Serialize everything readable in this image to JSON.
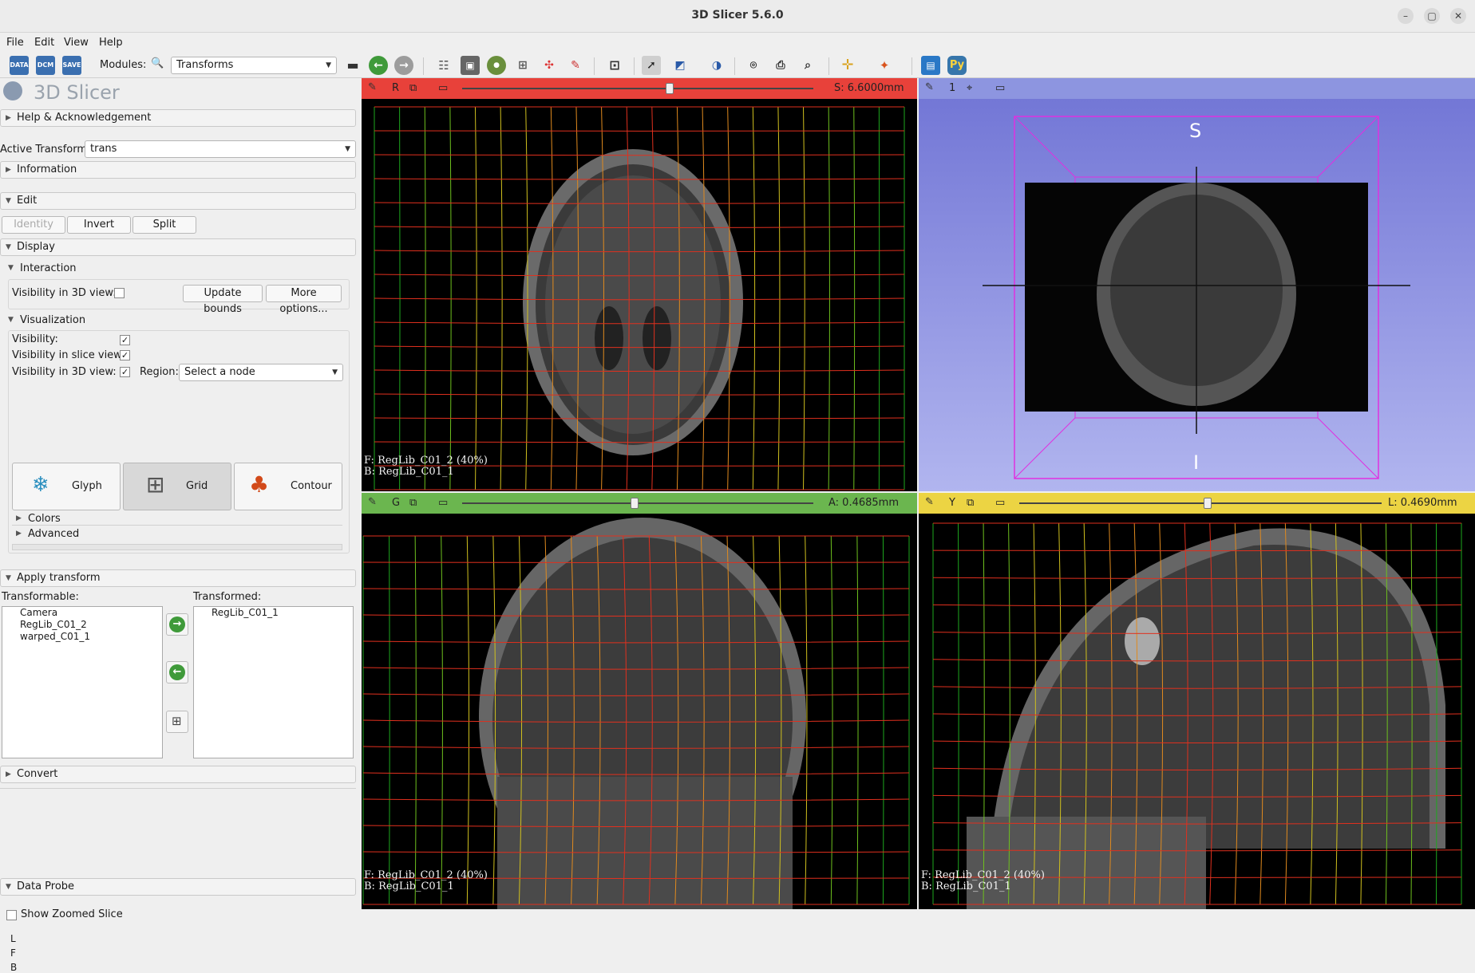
{
  "window": {
    "title": "3D Slicer 5.6.0"
  },
  "menu": [
    "File",
    "Edit",
    "View",
    "Help"
  ],
  "toolbar": {
    "data_btn": "DATA",
    "dcm_btn": "DCM",
    "save_btn": "SAVE",
    "modules_label": "Modules:",
    "module_selected": "Transforms"
  },
  "logo_text": "3D Slicer",
  "panels": {
    "help": "Help & Acknowledgement",
    "active_transform_label": "Active Transform:",
    "active_transform_value": "trans",
    "information": "Information",
    "edit": "Edit",
    "identity": "Identity",
    "invert": "Invert",
    "split": "Split",
    "display": "Display",
    "interaction": "Interaction",
    "vis3d_label": "Visibility in 3D view:",
    "update_bounds": "Update bounds",
    "more_options": "More options...",
    "visualization": "Visualization",
    "visibility_label": "Visibility:",
    "vis_slice_label": "Visibility in slice view:",
    "vis3d_label2": "Visibility in 3D view:",
    "region_label": "Region:",
    "region_value": "Select a node",
    "glyph": "Glyph",
    "grid": "Grid",
    "contour": "Contour",
    "colors": "Colors",
    "advanced": "Advanced",
    "apply_transform": "Apply transform",
    "transformable_label": "Transformable:",
    "transformed_label": "Transformed:",
    "transformable_items": [
      "Camera",
      "RegLib_C01_2",
      "warped_C01_1"
    ],
    "transformed_items": [
      "RegLib_C01_1"
    ],
    "convert": "Convert",
    "data_probe": "Data Probe",
    "show_zoomed": "Show Zoomed Slice",
    "probe_lines": [
      "L",
      "F",
      "B"
    ]
  },
  "views": {
    "red": {
      "letter": "R",
      "offset": "S: 6.6000mm",
      "fg": "F: RegLib_C01_2 (40%)",
      "bg": "B: RegLib_C01_1",
      "slider_pos": 0.59,
      "color": "#e8413a"
    },
    "threed": {
      "letter": "1",
      "s_label": "S",
      "i_label": "I",
      "color": "#8d95e0"
    },
    "green": {
      "letter": "G",
      "offset": "A: 0.4685mm",
      "fg": "F: RegLib_C01_2 (40%)",
      "bg": "B: RegLib_C01_1",
      "slider_pos": 0.49,
      "color": "#6bb64f"
    },
    "yellow": {
      "letter": "Y",
      "offset": "L: 0.4690mm",
      "fg": "F: RegLib_C01_2 (40%)",
      "bg": "B: RegLib_C01_1",
      "slider_pos": 0.52,
      "color": "#ecd443"
    }
  }
}
